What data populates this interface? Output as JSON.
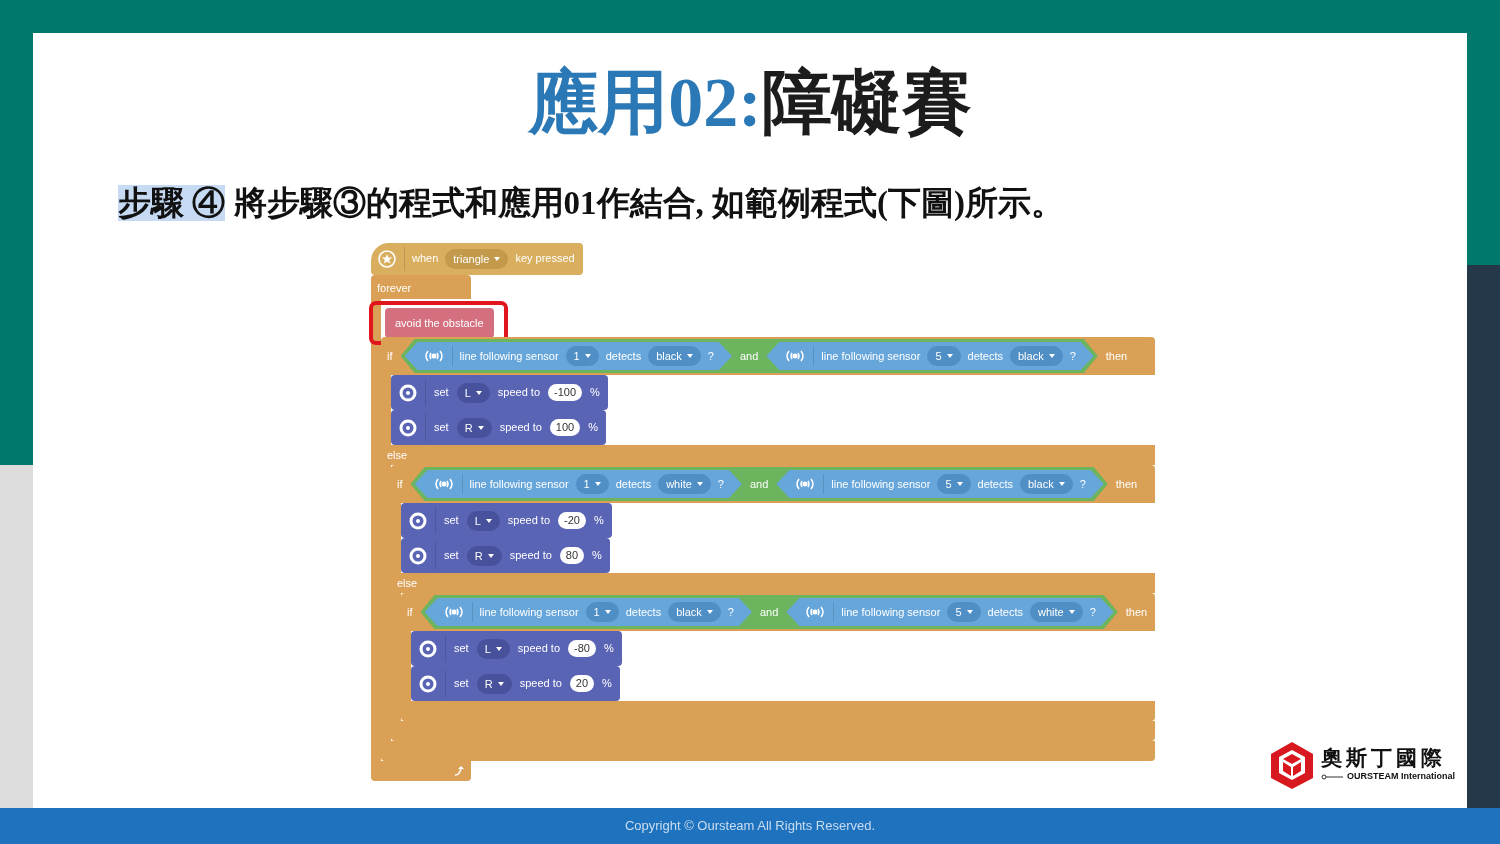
{
  "title": {
    "accent": "應用02:",
    "rest": "障礙賽"
  },
  "step": {
    "marked": "步驟 ④",
    "rest": " 將步驟③的程式和應用01作結合, 如範例程式(下圖)所示。"
  },
  "program": {
    "hat": {
      "label": "when",
      "key": "triangle",
      "suffix": "key pressed"
    },
    "forever": {
      "label": "forever",
      "body": [
        {
          "kind": "call",
          "label": "avoid the obstacle",
          "highlighted": true
        },
        {
          "kind": "if",
          "label": "if",
          "condition": {
            "left": {
              "label": "line following sensor",
              "port": "1",
              "verb": "detects",
              "target": "black",
              "mark": "?"
            },
            "op": "and",
            "right": {
              "label": "line following sensor",
              "port": "5",
              "verb": "detects",
              "target": "black",
              "mark": "?"
            }
          },
          "then_label": "then",
          "body": [
            {
              "kind": "motor",
              "set": "set",
              "motor": "L",
              "speed_to": "speed to",
              "value": "-100",
              "unit": "%"
            },
            {
              "kind": "motor",
              "set": "set",
              "motor": "R",
              "speed_to": "speed to",
              "value": "100",
              "unit": "%"
            }
          ],
          "else_label": "else",
          "else_body": [
            {
              "kind": "if",
              "label": "if",
              "condition": {
                "left": {
                  "label": "line following sensor",
                  "port": "1",
                  "verb": "detects",
                  "target": "white",
                  "mark": "?"
                },
                "op": "and",
                "right": {
                  "label": "line following sensor",
                  "port": "5",
                  "verb": "detects",
                  "target": "black",
                  "mark": "?"
                }
              },
              "then_label": "then",
              "body": [
                {
                  "kind": "motor",
                  "set": "set",
                  "motor": "L",
                  "speed_to": "speed to",
                  "value": "-20",
                  "unit": "%"
                },
                {
                  "kind": "motor",
                  "set": "set",
                  "motor": "R",
                  "speed_to": "speed to",
                  "value": "80",
                  "unit": "%"
                }
              ],
              "else_label": "else",
              "else_body": [
                {
                  "kind": "if",
                  "label": "if",
                  "condition": {
                    "left": {
                      "label": "line following sensor",
                      "port": "1",
                      "verb": "detects",
                      "target": "black",
                      "mark": "?"
                    },
                    "op": "and",
                    "right": {
                      "label": "line following sensor",
                      "port": "5",
                      "verb": "detects",
                      "target": "white",
                      "mark": "?"
                    }
                  },
                  "then_label": "then",
                  "body": [
                    {
                      "kind": "motor",
                      "set": "set",
                      "motor": "L",
                      "speed_to": "speed to",
                      "value": "-80",
                      "unit": "%"
                    },
                    {
                      "kind": "motor",
                      "set": "set",
                      "motor": "R",
                      "speed_to": "speed to",
                      "value": "20",
                      "unit": "%"
                    }
                  ]
                }
              ]
            }
          ]
        }
      ]
    }
  },
  "logo": {
    "name": "奧斯丁國際",
    "tagline": "OURSTEAM International"
  },
  "footer": "Copyright © Oursteam All Rights Reserved."
}
